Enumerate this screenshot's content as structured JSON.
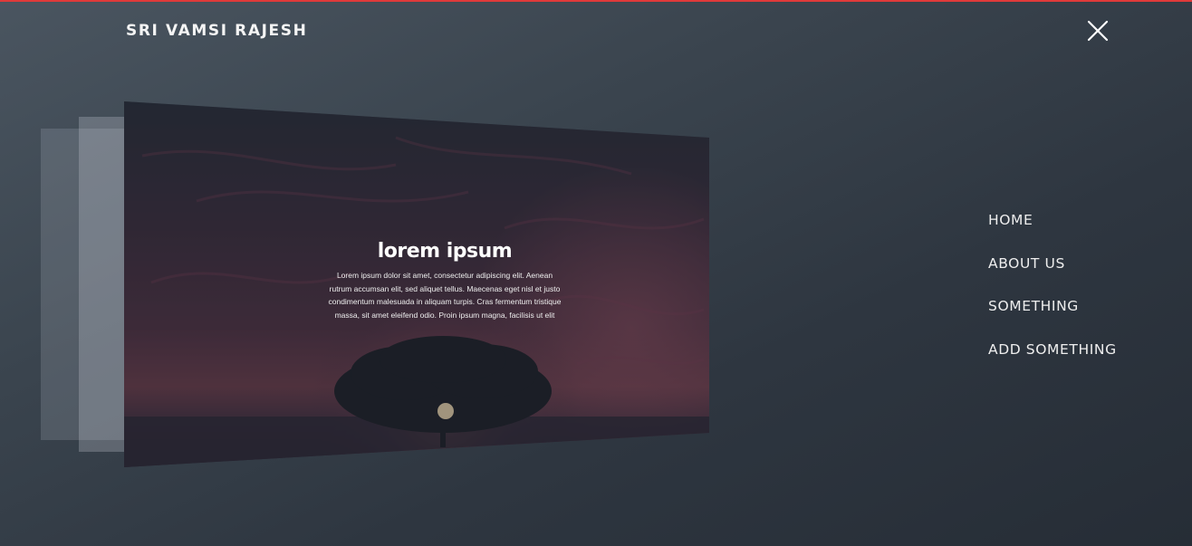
{
  "header": {
    "brand": "SRI VAMSI RAJESH",
    "close_icon": "close-icon",
    "accent_color": "#e03a3a"
  },
  "slider": {
    "active_slide": {
      "title": "lorem ipsum",
      "body": "Lorem ipsum dolor sit amet, consectetur adipiscing elit. Aenean rutrum accumsan elit, sed aliquet tellus. Maecenas eget nisl et justo condimentum malesuada in aliquam turpis. Cras fermentum tristique massa, sit amet eleifend odio. Proin ipsum magna, facilisis ut elit",
      "image": "sunset-tree-image"
    }
  },
  "nav": {
    "items": [
      {
        "label": "HOME"
      },
      {
        "label": "ABOUT US"
      },
      {
        "label": "SOMETHING"
      },
      {
        "label": "ADD SOMETHING"
      }
    ]
  },
  "colors": {
    "background": "#353e48",
    "text": "#ffffff"
  }
}
